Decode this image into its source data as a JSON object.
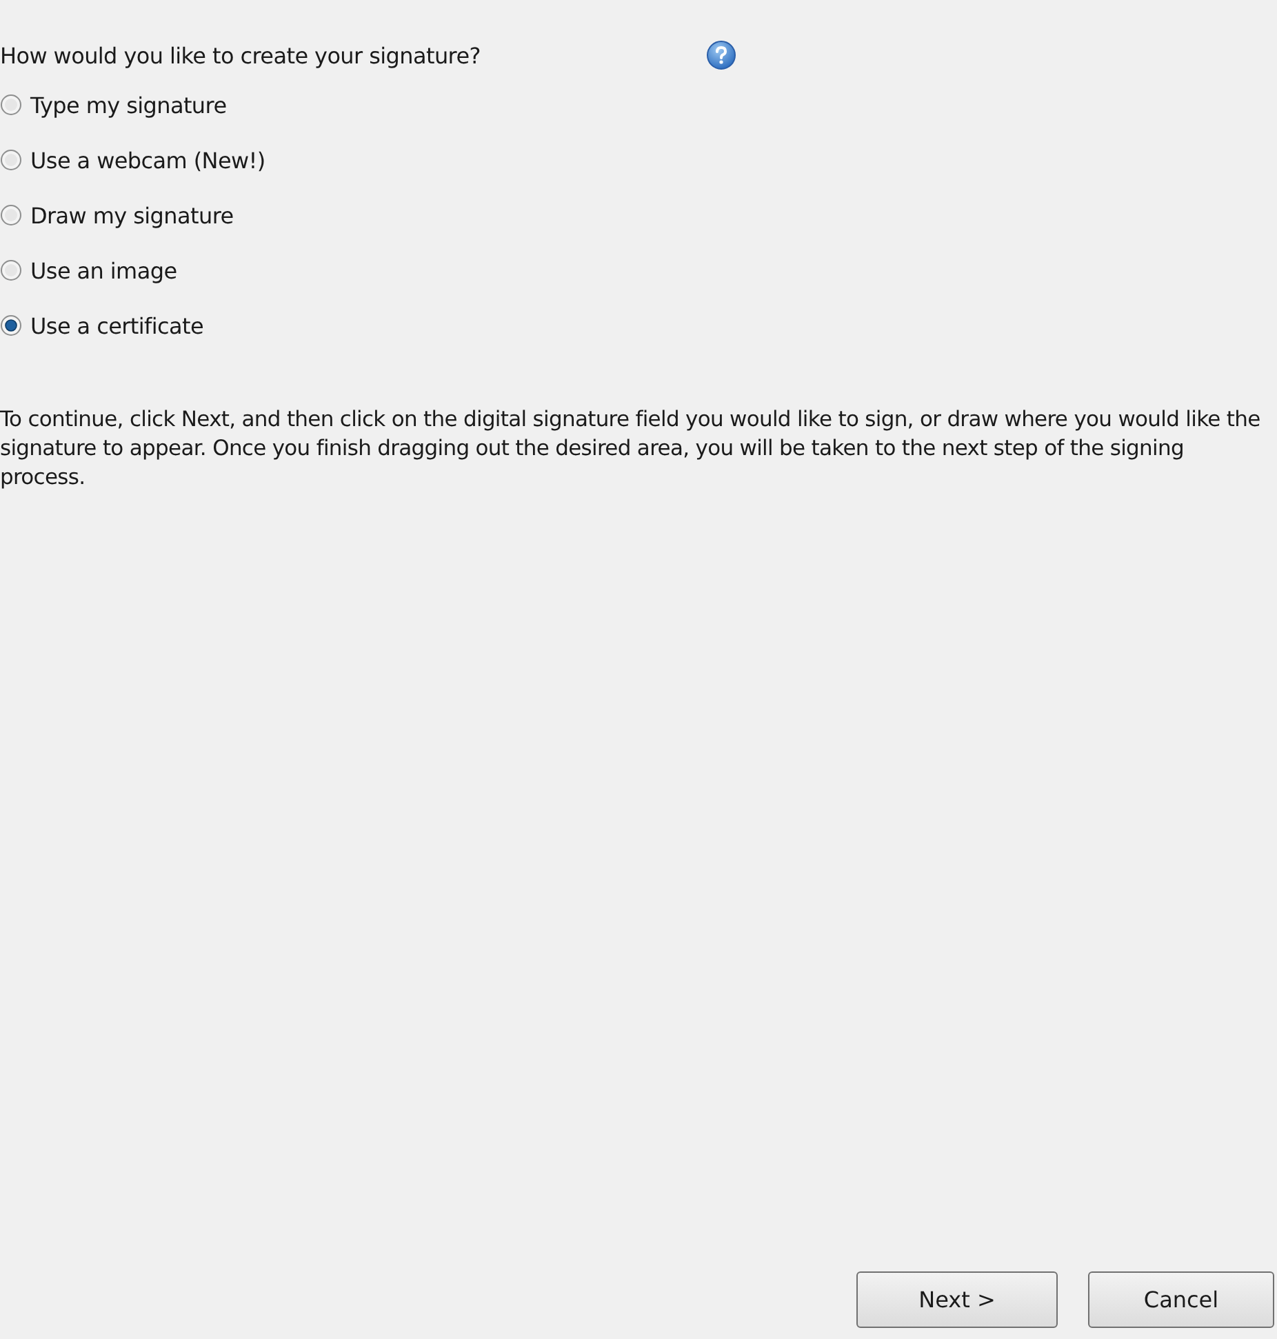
{
  "question": {
    "label": "How would you like to create your signature?"
  },
  "options": [
    {
      "label": "Type my signature",
      "selected": false
    },
    {
      "label": "Use a webcam (New!)",
      "selected": false
    },
    {
      "label": "Draw my signature",
      "selected": false
    },
    {
      "label": "Use an image",
      "selected": false
    },
    {
      "label": "Use a certificate",
      "selected": true
    }
  ],
  "instructions": "To continue, click Next, and then click on the digital signature field you would like to sign, or draw where you would like the signature to appear. Once you finish dragging out the desired area, you will be taken to the next step of the signing process.",
  "buttons": [
    "Next >",
    "Cancel"
  ]
}
